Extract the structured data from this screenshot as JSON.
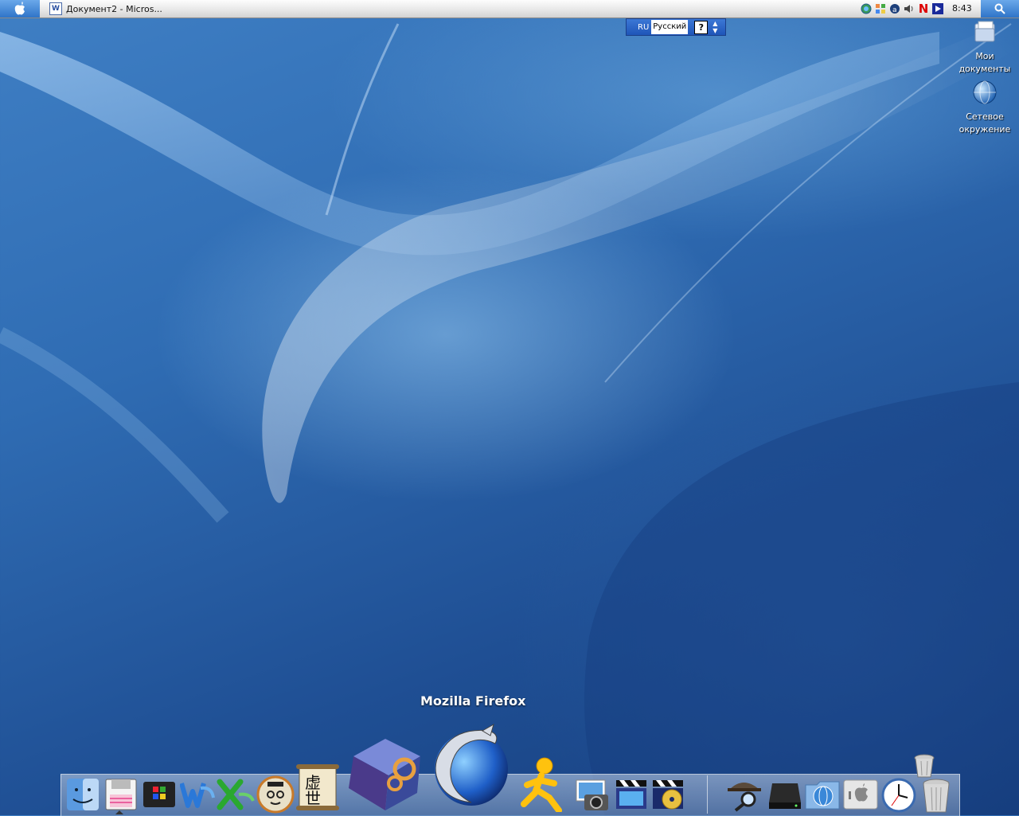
{
  "menubar": {
    "apple_icon": "apple-logo-icon",
    "task_title": "Документ2 - Micros...",
    "task_icon": "word-document-icon",
    "tray_icons": [
      "network-globe-icon",
      "color-squares-icon",
      "antivirus-icon",
      "volume-icon",
      "n-app-icon",
      "media-player-icon"
    ],
    "clock": "8:43",
    "search_icon": "spotlight-search-icon"
  },
  "langbar": {
    "code": "RU",
    "name": "Русский",
    "help": "?"
  },
  "desktop_icons": [
    {
      "label": "Мои документы",
      "icon": "my-documents-folder-icon"
    },
    {
      "label": "Сетевое окружение",
      "icon": "network-globe-icon"
    }
  ],
  "dock": {
    "tooltip": "Mozilla Firefox",
    "items": [
      "finder-icon",
      "total-commander-icon",
      "windows-icon",
      "word-icon",
      "excel-icon",
      "dictionary-professor-icon",
      "chinese-scroll-icon",
      "system-cube-icon",
      "firefox-icon",
      "aim-running-man-icon",
      "photo-camera-icon",
      "imovie-clapper-icon",
      "idvd-clapper-icon",
      "sherlock-search-icon",
      "hard-drive-icon",
      "network-folder-icon",
      "apple-system-icon",
      "clock-icon",
      "trash-icon"
    ]
  },
  "colors": {
    "menubar_accent": "#2f74c8",
    "desktop_blue": "#2f6cb3"
  }
}
